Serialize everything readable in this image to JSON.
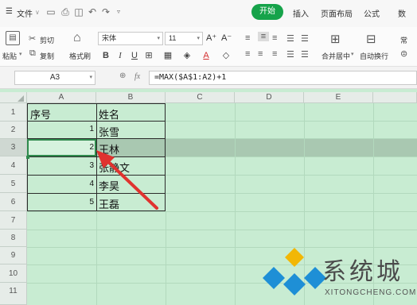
{
  "menubar": {
    "hamburger_icon": "☰",
    "file_label": "文件",
    "tabs": [
      "开始",
      "插入",
      "页面布局",
      "公式",
      "数"
    ],
    "quick_icons": [
      "save-icon",
      "print-icon",
      "preview-icon",
      "undo-icon",
      "redo-icon",
      "more-icon"
    ]
  },
  "ribbon": {
    "paste_label": "粘贴",
    "cut_label": "剪切",
    "copy_label": "复制",
    "format_painter_label": "格式刷",
    "font_name": "宋体",
    "font_size": "11",
    "font_grow": "A⁺",
    "font_shrink": "A⁻",
    "bold": "B",
    "italic": "I",
    "underline": "U",
    "font_color_glyph": "A",
    "merge_label": "合并居中",
    "wrap_label": "自动换行",
    "normal_label": "常"
  },
  "formula_bar": {
    "name_box": "A3",
    "zoom_icon": "🔍",
    "fx": "fx",
    "formula": "=MAX($A$1:A2)+1"
  },
  "grid": {
    "columns": [
      "A",
      "B",
      "C",
      "D",
      "E"
    ],
    "rows": [
      "1",
      "2",
      "3",
      "4",
      "5",
      "6",
      "7",
      "8",
      "9",
      "10",
      "11"
    ],
    "header": {
      "a": "序号",
      "b": "姓名"
    },
    "data": [
      {
        "num": "1",
        "name": "张雪"
      },
      {
        "num": "2",
        "name": "王林"
      },
      {
        "num": "3",
        "name": "张静文"
      },
      {
        "num": "4",
        "name": "李昊"
      },
      {
        "num": "5",
        "name": "王磊"
      }
    ],
    "selected_row": "3"
  },
  "watermark": {
    "text": "系统城",
    "url": "XITONGCHENG.COM"
  },
  "colors": {
    "accent_green": "#16a34a",
    "grid_background": "#c8ecd2",
    "arrow_red": "#e0332f"
  }
}
